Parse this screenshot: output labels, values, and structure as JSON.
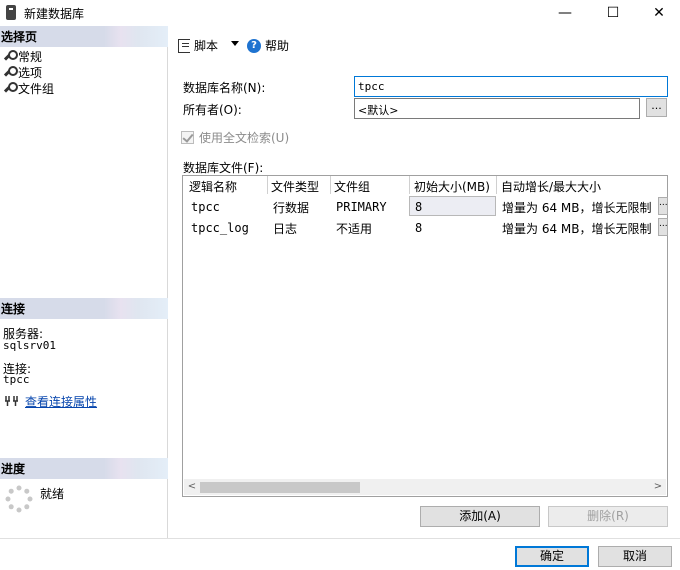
{
  "window": {
    "title": "新建数据库",
    "minimize_glyph": "—",
    "maximize_glyph": "☐",
    "close_glyph": "✕"
  },
  "left_pane": {
    "select_page_header": "选择页",
    "pages": [
      {
        "label": "常规",
        "icon": "wrench-icon"
      },
      {
        "label": "选项",
        "icon": "wrench-icon"
      },
      {
        "label": "文件组",
        "icon": "wrench-icon"
      }
    ],
    "connection_header": "连接",
    "server_label": "服务器:",
    "server_value": "sqlsrv01",
    "connection_label": "连接:",
    "connection_value": "tpcc",
    "view_connection_props": "查看连接属性",
    "progress_header": "进度",
    "progress_status": "就绪"
  },
  "toolbar": {
    "script_label": "脚本",
    "help_label": "帮助"
  },
  "form": {
    "db_name_label": "数据库名称(N):",
    "db_name_value": "tpcc",
    "owner_label": "所有者(O):",
    "owner_value": "<默认>",
    "browse_label": "...",
    "fulltext_label": "使用全文检索(U)",
    "files_label": "数据库文件(F):"
  },
  "files_table": {
    "columns": [
      "逻辑名称",
      "文件类型",
      "文件组",
      "初始大小(MB)",
      "自动增长/最大大小"
    ],
    "rows": [
      {
        "logical_name": "tpcc",
        "file_type": "行数据",
        "filegroup": "PRIMARY",
        "initial_size": "8",
        "autogrowth": "增量为 64 MB，增长无限制"
      },
      {
        "logical_name": "tpcc_log",
        "file_type": "日志",
        "filegroup": "不适用",
        "initial_size": "8",
        "autogrowth": "增量为 64 MB，增长无限制"
      }
    ],
    "scroll_left": "<",
    "scroll_right": ">",
    "ellipsis": "..."
  },
  "buttons": {
    "add": "添加(A)",
    "remove": "删除(R)",
    "ok": "确定",
    "cancel": "取消"
  }
}
